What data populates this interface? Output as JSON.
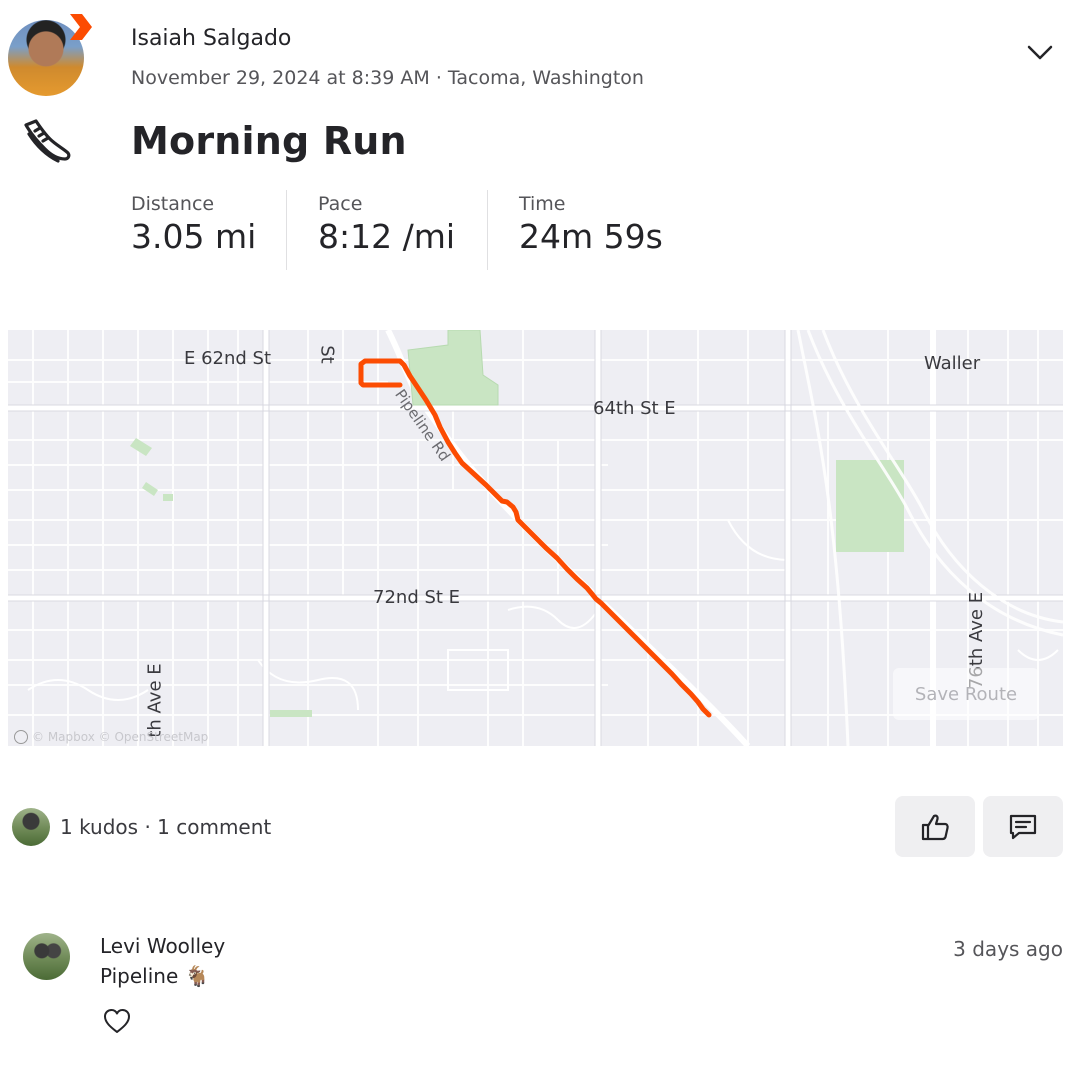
{
  "header": {
    "athlete_name": "Isaiah Salgado",
    "date_time": "November 29, 2024 at 8:39 AM",
    "separator": "·",
    "location": "Tacoma, Washington",
    "activity_type_icon": "running-shoe-icon",
    "menu_icon": "chevron-down-icon"
  },
  "activity": {
    "title": "Morning Run",
    "stats": [
      {
        "label": "Distance",
        "value": "3.05 mi"
      },
      {
        "label": "Pace",
        "value": "8:12 /mi"
      },
      {
        "label": "Time",
        "value": "24m 59s"
      }
    ]
  },
  "map": {
    "street_labels": [
      "E 62nd St",
      "St",
      "64th St E",
      "72nd St E",
      "Waller",
      "Pipeline Rd",
      "th Ave E",
      "76th Ave E"
    ],
    "save_route_label": "Save Route",
    "attribution": "© Mapbox © OpenStreetMap",
    "route_color": "#fc4c02"
  },
  "social": {
    "kudos_text": "1 kudos",
    "separator": "·",
    "comment_count_text": "1 comment",
    "kudos_button_icon": "thumbs-up-icon",
    "comment_button_icon": "comment-icon"
  },
  "comments": [
    {
      "author": "Levi Woolley",
      "text": "Pipeline 🐐",
      "time": "3 days ago"
    }
  ],
  "colors": {
    "brand": "#fc4c02",
    "text": "#242428",
    "muted": "#555559",
    "map_bg": "#eeeef3"
  }
}
